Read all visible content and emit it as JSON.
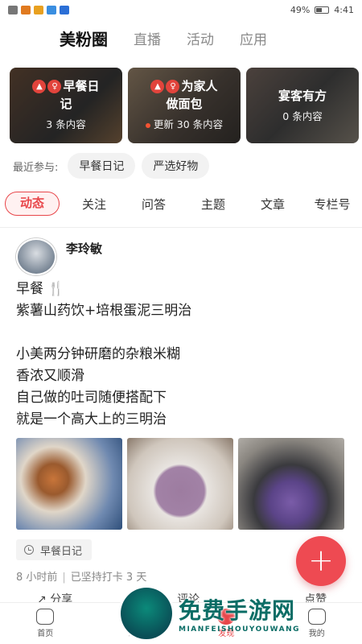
{
  "statusbar": {
    "battery": "49%",
    "time": "4:41"
  },
  "top_tabs": [
    "美粉圈",
    "直播",
    "活动",
    "应用"
  ],
  "cards": [
    {
      "title_line1": "早餐日",
      "title_line2": "记",
      "sub": "3 条内容",
      "icons": true
    },
    {
      "title_line1": "为家人",
      "title_line2": "做面包",
      "sub": "更新 30 条内容",
      "icons": true,
      "dot": true
    },
    {
      "title_line1": "宴客有方",
      "title_line2": "",
      "sub": "0 条内容",
      "icons": false
    }
  ],
  "recent": {
    "label": "最近参与:",
    "chips": [
      "早餐日记",
      "严选好物"
    ]
  },
  "sub_tabs": [
    "动态",
    "关注",
    "问答",
    "主题",
    "文章",
    "专栏号"
  ],
  "post": {
    "author": "李玲敏",
    "lines": [
      "早餐 🍴",
      "紫薯山药饮+培根蛋泥三明治",
      "",
      "小美两分钟研磨的杂粮米糊",
      "香浓又顺滑",
      "自己做的吐司随便搭配下",
      "就是一个高大上的三明治"
    ],
    "tag": "早餐日记",
    "time": "8 小时前",
    "streak": "已坚持打卡 3 天",
    "actions": [
      "分享",
      "评论",
      "点赞"
    ]
  },
  "fab": "+",
  "bottom_nav": [
    "首页",
    "课堂",
    "发现",
    "我的"
  ],
  "watermark": {
    "big": "免费手游网",
    "small": "MIANFEISHOUYOUWANG"
  }
}
